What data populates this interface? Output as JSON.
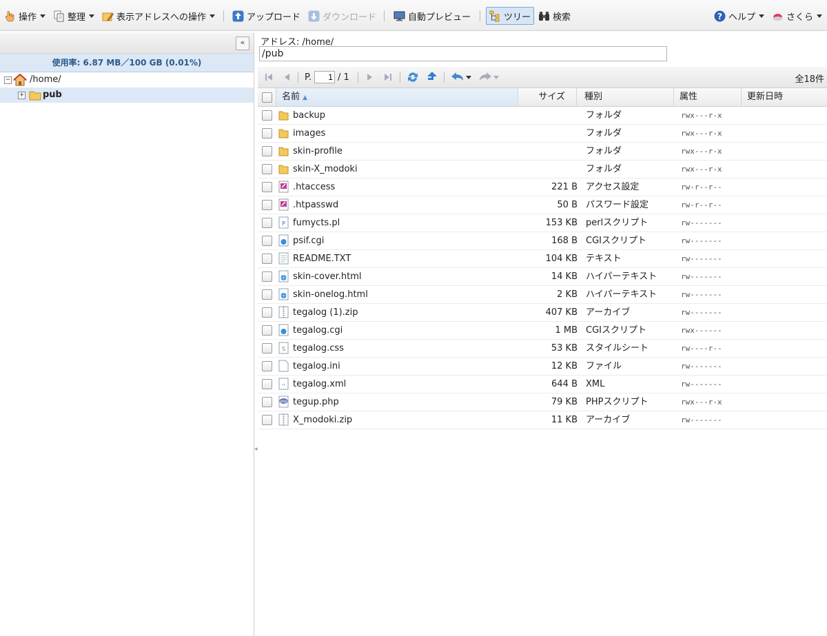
{
  "toolbar": {
    "operation": "操作",
    "organize": "整理",
    "address_ops": "表示アドレスへの操作",
    "upload": "アップロード",
    "download": "ダウンロード",
    "auto_preview": "自動プレビュー",
    "tree": "ツリー",
    "search": "検索",
    "help": "ヘルプ",
    "sakura": "さくら"
  },
  "left": {
    "usage": "使用率: 6.87 MB／100 GB (0.01%)",
    "tree_root": "/home/",
    "tree_child": "pub"
  },
  "address": {
    "label": "アドレス: /home/",
    "value": "/pub"
  },
  "nav": {
    "page_prefix": "P.",
    "page_value": "1",
    "page_total": "/ 1",
    "count": "全18件"
  },
  "table": {
    "headers": {
      "name": "名前",
      "size": "サイズ",
      "type": "種別",
      "perm": "属性",
      "date": "更新日時"
    },
    "rows": [
      {
        "name": "backup",
        "size": "",
        "type": "フォルダ",
        "perm": "rwx---r-x",
        "icon": "folder-icon"
      },
      {
        "name": "images",
        "size": "",
        "type": "フォルダ",
        "perm": "rwx---r-x",
        "icon": "folder-icon"
      },
      {
        "name": "skin-profile",
        "size": "",
        "type": "フォルダ",
        "perm": "rwx---r-x",
        "icon": "folder-icon"
      },
      {
        "name": "skin-X_modoki",
        "size": "",
        "type": "フォルダ",
        "perm": "rwx---r-x",
        "icon": "folder-icon"
      },
      {
        "name": ".htaccess",
        "size": "221 B",
        "type": "アクセス設定",
        "perm": "rw-r--r--",
        "icon": "access-file-icon"
      },
      {
        "name": ".htpasswd",
        "size": "50 B",
        "type": "パスワード設定",
        "perm": "rw-r--r--",
        "icon": "password-file-icon"
      },
      {
        "name": "fumycts.pl",
        "size": "153 KB",
        "type": "perlスクリプト",
        "perm": "rw-------",
        "icon": "perl-file-icon"
      },
      {
        "name": "psif.cgi",
        "size": "168 B",
        "type": "CGIスクリプト",
        "perm": "rw-------",
        "icon": "cgi-file-icon"
      },
      {
        "name": "README.TXT",
        "size": "104 KB",
        "type": "テキスト",
        "perm": "rw-------",
        "icon": "text-file-icon"
      },
      {
        "name": "skin-cover.html",
        "size": "14 KB",
        "type": "ハイパーテキスト",
        "perm": "rw-------",
        "icon": "html-file-icon"
      },
      {
        "name": "skin-onelog.html",
        "size": "2 KB",
        "type": "ハイパーテキスト",
        "perm": "rw-------",
        "icon": "html-file-icon"
      },
      {
        "name": "tegalog (1).zip",
        "size": "407 KB",
        "type": "アーカイブ",
        "perm": "rw-------",
        "icon": "zip-file-icon"
      },
      {
        "name": "tegalog.cgi",
        "size": "1 MB",
        "type": "CGIスクリプト",
        "perm": "rwx------",
        "icon": "cgi-file-icon"
      },
      {
        "name": "tegalog.css",
        "size": "53 KB",
        "type": "スタイルシート",
        "perm": "rw----r--",
        "icon": "css-file-icon"
      },
      {
        "name": "tegalog.ini",
        "size": "12 KB",
        "type": "ファイル",
        "perm": "rw-------",
        "icon": "generic-file-icon"
      },
      {
        "name": "tegalog.xml",
        "size": "644 B",
        "type": "XML",
        "perm": "rw-------",
        "icon": "xml-file-icon"
      },
      {
        "name": "tegup.php",
        "size": "79 KB",
        "type": "PHPスクリプト",
        "perm": "rwx---r-x",
        "icon": "php-file-icon"
      },
      {
        "name": "X_modoki.zip",
        "size": "11 KB",
        "type": "アーカイブ",
        "perm": "rw-------",
        "icon": "zip-file-icon"
      }
    ]
  }
}
